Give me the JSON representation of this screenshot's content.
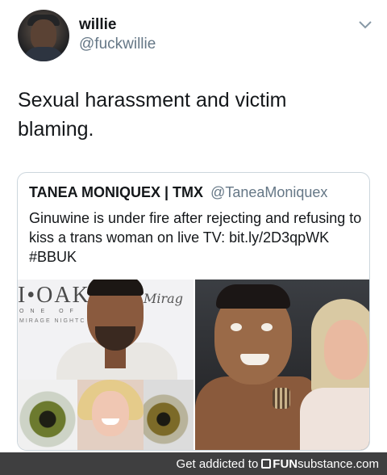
{
  "tweet": {
    "display_name": "willie",
    "handle": "@fuckwillie",
    "text": "Sexual harassment and victim blaming."
  },
  "quoted_tweet": {
    "name": "TANEA MONIQUEX | TMX",
    "handle": "@TaneaMoniquex",
    "text": "Ginuwine is under fire after rejecting and refusing to kiss a trans woman on live TV: bit.ly/2D3qpWK #BBUK"
  },
  "media": {
    "logo_text": "I•OAK",
    "logo_sub": "ONE OF A K",
    "logo_sub2": "MIRAGE NIGHTC",
    "script_text": "Mirag"
  },
  "footer": {
    "lead": "Get addicted to",
    "brand_fun": "FUN",
    "brand_rest": "substance.com"
  },
  "colors": {
    "text": "#14171a",
    "secondary": "#657786",
    "border": "#ccd6dd",
    "footer_bg": "#3f3f40"
  },
  "icons": {
    "menu": "chevron-down-icon",
    "brand": "funsubstance-logo-icon"
  }
}
